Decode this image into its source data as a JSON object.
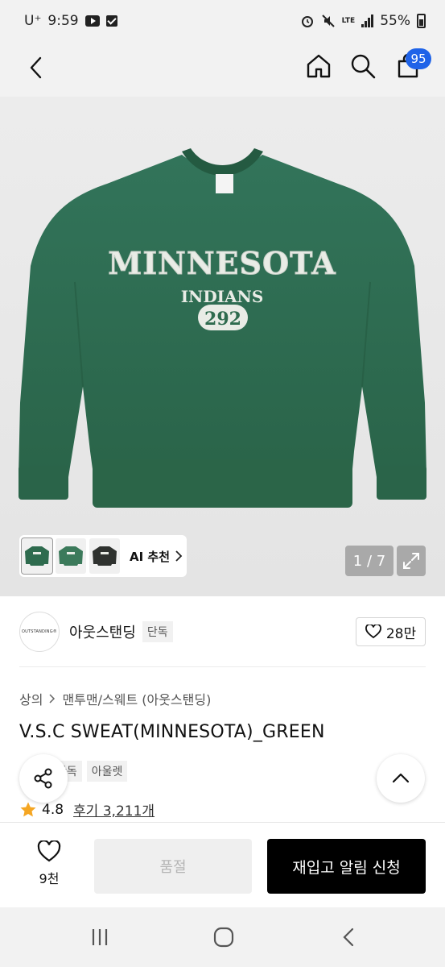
{
  "status_bar": {
    "carrier": "U⁺",
    "time": "9:59",
    "network": "LTE",
    "battery": "55%"
  },
  "header": {
    "cart_count": "95"
  },
  "gallery": {
    "ai_label": "AI 추천",
    "counter": "1 / 7",
    "shirt_text": {
      "line1": "MINNESOTA",
      "line2": "INDIANS",
      "number": "292"
    },
    "colors": {
      "shirt": "#2e6b4e",
      "shirt_dark": "#245a41",
      "print": "#e9ece6"
    }
  },
  "brand": {
    "logo_text": "OUTSTANDING®",
    "name": "아웃스탠딩",
    "tag": "단독",
    "likes": "28만"
  },
  "breadcrumb": {
    "level1": "상의",
    "level2": "맨투맨/스웨트 (아웃스탠딩)"
  },
  "product": {
    "title": "V.S.C SWEAT(MINNESOTA)_GREEN",
    "tags": [
      "단독",
      "아울렛"
    ],
    "rating": "4.8",
    "reviews": "후기 3,211개"
  },
  "actions": {
    "wish_count": "9천",
    "soldout_label": "품절",
    "restock_label": "재입고 알림 신청"
  },
  "accent_colors": {
    "badge": "#1f63e8",
    "star": "#f5a623"
  }
}
